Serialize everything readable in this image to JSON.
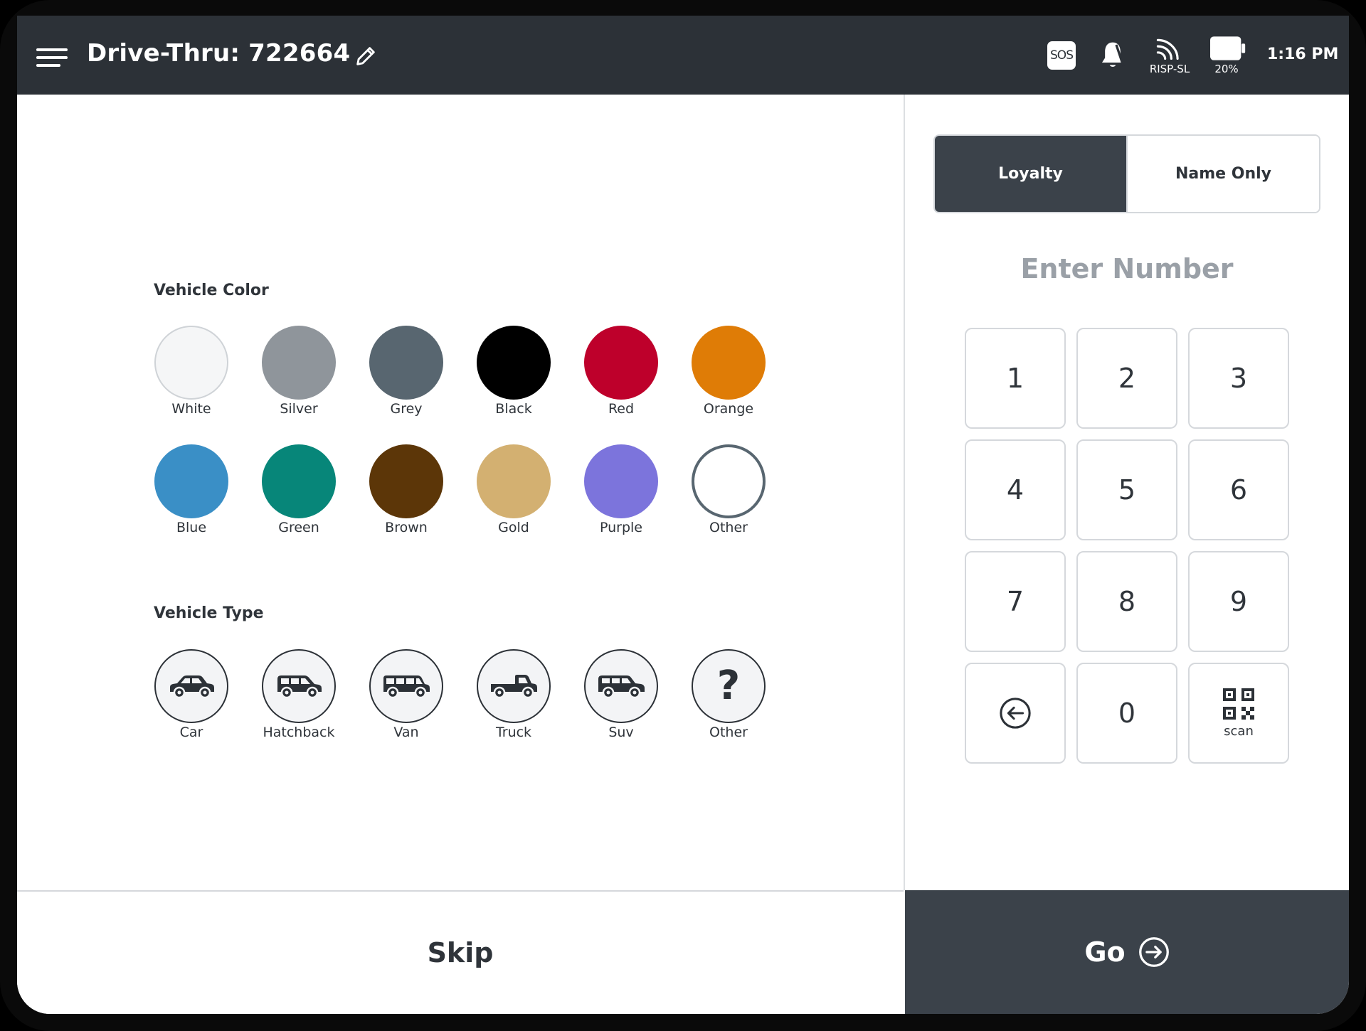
{
  "header": {
    "title": "Drive-Thru: 722664",
    "network_label": "RISP-SL",
    "battery_label": "20%",
    "time": "1:16 PM",
    "sos_label": "SOS"
  },
  "vehicle_color": {
    "title": "Vehicle Color",
    "colors": [
      {
        "label": "White",
        "hex": "#f5f6f7"
      },
      {
        "label": "Silver",
        "hex": "#8f959b"
      },
      {
        "label": "Grey",
        "hex": "#586670"
      },
      {
        "label": "Black",
        "hex": "#000000"
      },
      {
        "label": "Red",
        "hex": "#be002b"
      },
      {
        "label": "Orange",
        "hex": "#df7c06"
      },
      {
        "label": "Blue",
        "hex": "#3a8fc6"
      },
      {
        "label": "Green",
        "hex": "#078679"
      },
      {
        "label": "Brown",
        "hex": "#5c3608"
      },
      {
        "label": "Gold",
        "hex": "#d3b071"
      },
      {
        "label": "Purple",
        "hex": "#7c74dc"
      },
      {
        "label": "Other",
        "hex": "#ffffff"
      }
    ]
  },
  "vehicle_type": {
    "title": "Vehicle Type",
    "types": [
      {
        "label": "Car",
        "icon": "car-icon"
      },
      {
        "label": "Hatchback",
        "icon": "hatchback-icon"
      },
      {
        "label": "Van",
        "icon": "van-icon"
      },
      {
        "label": "Truck",
        "icon": "truck-icon"
      },
      {
        "label": "Suv",
        "icon": "suv-icon"
      },
      {
        "label": "Other",
        "icon": "question-icon",
        "glyph": "?"
      }
    ]
  },
  "tabs": {
    "loyalty": "Loyalty",
    "name_only": "Name Only"
  },
  "keypad": {
    "prompt": "Enter Number",
    "keys": [
      "1",
      "2",
      "3",
      "4",
      "5",
      "6",
      "7",
      "8",
      "9",
      "0"
    ],
    "scan_label": "scan"
  },
  "actions": {
    "skip": "Skip",
    "go": "Go"
  },
  "theme": {
    "header_bg": "#2c3137",
    "accent_dark": "#3b424a",
    "muted_text": "#9aa0a7"
  }
}
